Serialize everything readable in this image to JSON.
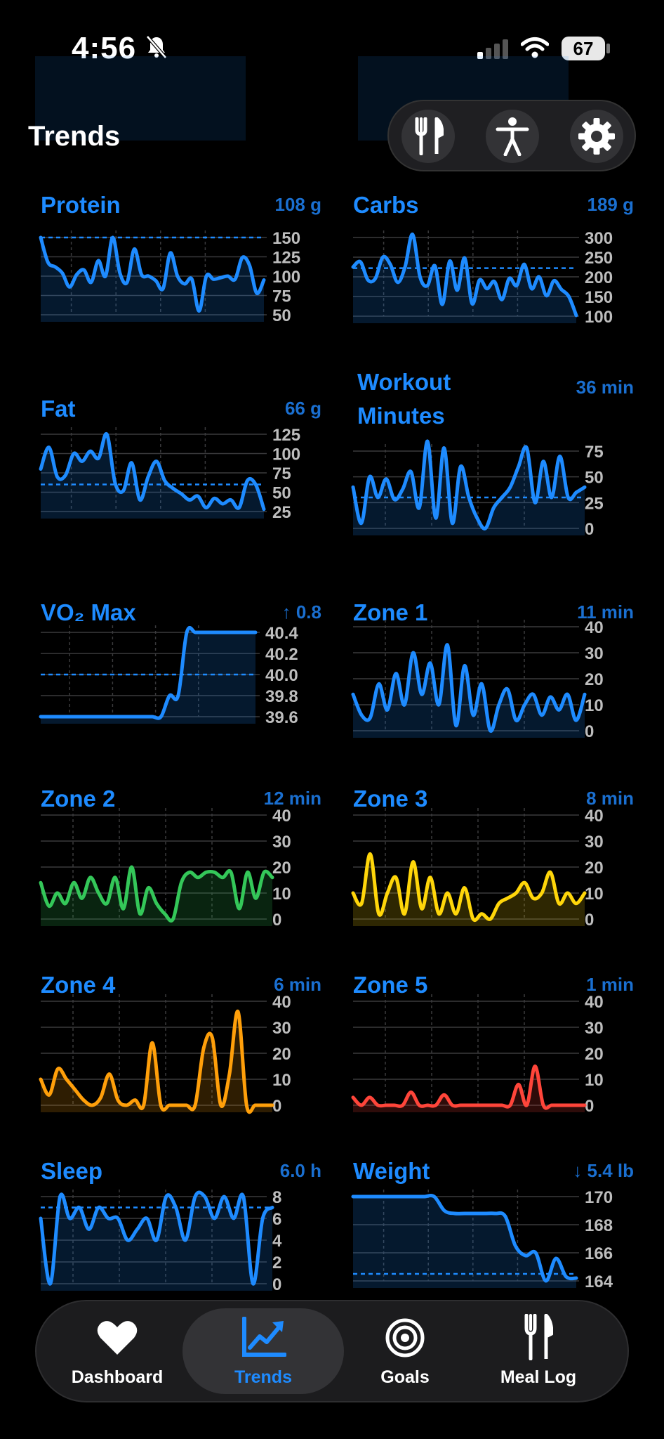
{
  "status": {
    "time": "4:56",
    "battery": "67"
  },
  "header": {
    "title": "Trends"
  },
  "toolbar": {
    "items": [
      "fork-knife-icon",
      "accessibility-icon",
      "gear-icon"
    ]
  },
  "colors": {
    "accent": "#1e8bff",
    "green": "#34c759",
    "yellow": "#ffd60a",
    "orange": "#ff9f0a",
    "red": "#ff453a"
  },
  "cards": [
    {
      "title": "Protein",
      "value": "108 g",
      "ticks": [
        "150",
        "125",
        "100",
        "75",
        "50"
      ],
      "color": "#1e8bff",
      "chart_data": {
        "type": "line",
        "ylim": [
          50,
          150
        ],
        "target": 150,
        "values": [
          150,
          118,
          112,
          104,
          86,
          102,
          108,
          92,
          120,
          100,
          150,
          104,
          92,
          135,
          102,
          100,
          94,
          84,
          130,
          100,
          90,
          96,
          55,
          100,
          96,
          98,
          100,
          96,
          124,
          114,
          78,
          95
        ]
      }
    },
    {
      "title": "Carbs",
      "value": "189 g",
      "ticks": [
        "300",
        "250",
        "200",
        "150",
        "100"
      ],
      "color": "#1e8bff",
      "chart_data": {
        "type": "line",
        "ylim": [
          100,
          300
        ],
        "target": 222,
        "values": [
          225,
          238,
          192,
          196,
          250,
          232,
          186,
          226,
          308,
          200,
          178,
          228,
          130,
          240,
          166,
          248,
          132,
          192,
          170,
          188,
          142,
          196,
          178,
          232,
          170,
          200,
          152,
          190,
          168,
          150,
          102
        ]
      }
    },
    {
      "title": "Fat",
      "value": "66 g",
      "ticks": [
        "125",
        "100",
        "75",
        "50",
        "25"
      ],
      "color": "#1e8bff",
      "chart_data": {
        "type": "line",
        "ylim": [
          25,
          125
        ],
        "target": 60,
        "values": [
          80,
          108,
          70,
          72,
          100,
          90,
          103,
          94,
          125,
          62,
          52,
          88,
          40,
          70,
          90,
          65,
          55,
          48,
          40,
          45,
          30,
          42,
          35,
          40,
          30,
          65,
          60,
          28
        ]
      }
    },
    {
      "title": "Workout Minutes",
      "value": "36 min",
      "ticks": [
        "75",
        "50",
        "25",
        "0"
      ],
      "color": "#1e8bff",
      "chart_data": {
        "type": "line",
        "ylim": [
          0,
          75
        ],
        "target": 30,
        "values": [
          40,
          5,
          50,
          30,
          48,
          28,
          38,
          55,
          20,
          85,
          10,
          78,
          5,
          60,
          30,
          10,
          0,
          20,
          30,
          40,
          60,
          78,
          25,
          65,
          30,
          70,
          30,
          35,
          40
        ]
      }
    },
    {
      "title": "VO₂ Max",
      "value": "↑ 0.8",
      "ticks": [
        "40.4",
        "40.2",
        "40.0",
        "39.8",
        "39.6"
      ],
      "color": "#1e8bff",
      "chart_data": {
        "type": "line",
        "ylim": [
          39.6,
          40.4
        ],
        "target": 40.0,
        "values": [
          39.6,
          39.6,
          39.6,
          39.6,
          39.6,
          39.6,
          39.6,
          39.6,
          39.6,
          39.6,
          39.6,
          39.6,
          39.6,
          39.6,
          39.6,
          39.8,
          39.8,
          40.4,
          40.4,
          40.4,
          40.4,
          40.4,
          40.4,
          40.4,
          40.4,
          40.4
        ]
      }
    },
    {
      "title": "Zone 1",
      "value": "11 min",
      "ticks": [
        "40",
        "30",
        "20",
        "10",
        "0"
      ],
      "color": "#1e8bff",
      "chart_data": {
        "type": "line",
        "ylim": [
          0,
          40
        ],
        "values": [
          14,
          6,
          5,
          18,
          8,
          22,
          10,
          30,
          14,
          26,
          10,
          33,
          2,
          25,
          6,
          18,
          0,
          10,
          16,
          4,
          10,
          14,
          6,
          13,
          8,
          14,
          4,
          14
        ]
      }
    },
    {
      "title": "Zone 2",
      "value": "12 min",
      "ticks": [
        "40",
        "30",
        "20",
        "10",
        "0"
      ],
      "color": "#34c759",
      "chart_data": {
        "type": "line",
        "ylim": [
          0,
          40
        ],
        "values": [
          14,
          5,
          10,
          6,
          14,
          8,
          16,
          10,
          6,
          16,
          4,
          20,
          2,
          12,
          6,
          2,
          0,
          14,
          18,
          16,
          18,
          18,
          16,
          18,
          4,
          18,
          8,
          18,
          16
        ]
      }
    },
    {
      "title": "Zone 3",
      "value": "8 min",
      "ticks": [
        "40",
        "30",
        "20",
        "10",
        "0"
      ],
      "color": "#ffd60a",
      "chart_data": {
        "type": "line",
        "ylim": [
          0,
          40
        ],
        "values": [
          10,
          6,
          25,
          2,
          10,
          16,
          2,
          22,
          4,
          16,
          2,
          10,
          2,
          12,
          0,
          2,
          0,
          6,
          8,
          10,
          14,
          8,
          10,
          18,
          6,
          10,
          6,
          10
        ]
      }
    },
    {
      "title": "Zone 4",
      "value": "6 min",
      "ticks": [
        "40",
        "30",
        "20",
        "10",
        "0"
      ],
      "color": "#ff9f0a",
      "chart_data": {
        "type": "line",
        "ylim": [
          0,
          40
        ],
        "values": [
          10,
          4,
          14,
          10,
          6,
          2,
          0,
          3,
          12,
          2,
          0,
          2,
          0,
          24,
          0,
          0,
          0,
          0,
          0,
          22,
          26,
          0,
          12,
          36,
          0,
          0,
          0,
          0
        ]
      }
    },
    {
      "title": "Zone 5",
      "value": "1 min",
      "ticks": [
        "40",
        "30",
        "20",
        "10",
        "0"
      ],
      "color": "#ff453a",
      "chart_data": {
        "type": "line",
        "ylim": [
          0,
          40
        ],
        "values": [
          3,
          0,
          3,
          0,
          0,
          0,
          0,
          5,
          0,
          0,
          0,
          4,
          0,
          0,
          0,
          0,
          0,
          0,
          0,
          0,
          8,
          0,
          15,
          0,
          0,
          0,
          0,
          0,
          0
        ]
      }
    },
    {
      "title": "Sleep",
      "value": "6.0 h",
      "ticks": [
        "8",
        "6",
        "4",
        "2",
        "0"
      ],
      "color": "#1e8bff",
      "chart_data": {
        "type": "line",
        "ylim": [
          0,
          8
        ],
        "target": 7,
        "values": [
          6,
          0,
          8,
          6,
          7,
          5,
          7,
          6,
          6,
          4,
          5,
          6,
          4,
          8,
          7,
          4,
          8,
          8,
          6,
          8,
          6,
          8,
          0,
          6,
          7
        ]
      }
    },
    {
      "title": "Weight",
      "value": "↓ 5.4 lb",
      "ticks": [
        "170",
        "168",
        "166",
        "164"
      ],
      "color": "#1e8bff",
      "chart_data": {
        "type": "line",
        "ylim": [
          164,
          170
        ],
        "target": 164.5,
        "values": [
          170,
          170,
          170,
          170,
          170,
          170,
          170,
          170,
          170,
          169,
          168.8,
          168.8,
          168.8,
          168.8,
          168.8,
          168.6,
          166.5,
          165.8,
          166,
          164,
          165.6,
          164.3,
          164.2
        ]
      }
    }
  ],
  "tabbar": {
    "tabs": [
      {
        "label": "Dashboard",
        "icon": "heart-icon",
        "active": false
      },
      {
        "label": "Trends",
        "icon": "chart-icon",
        "active": true
      },
      {
        "label": "Goals",
        "icon": "target-icon",
        "active": false
      },
      {
        "label": "Meal Log",
        "icon": "fork-knife-icon",
        "active": false
      }
    ]
  }
}
